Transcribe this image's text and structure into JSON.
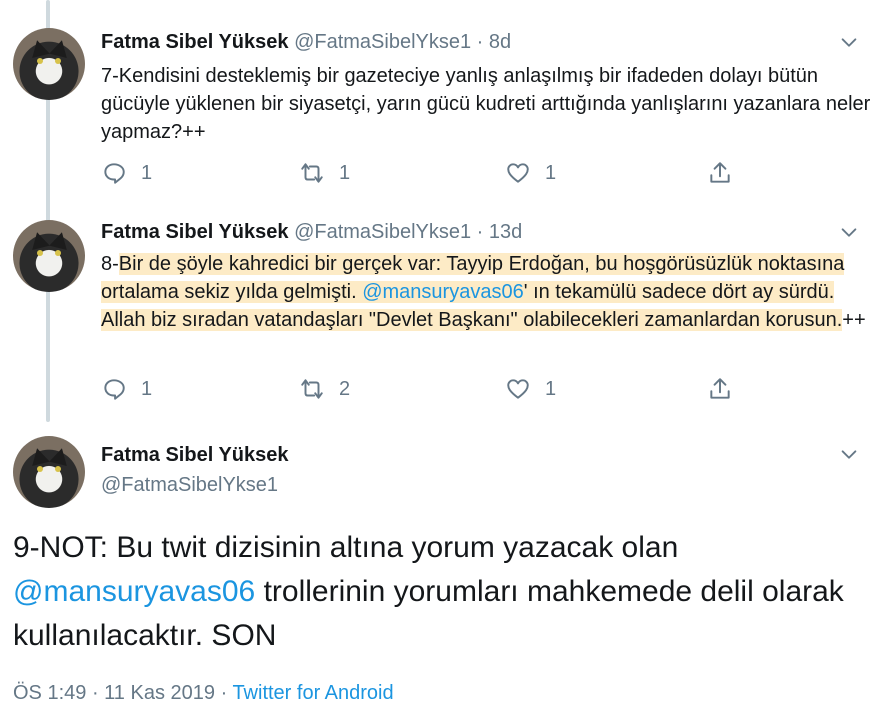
{
  "tweets": [
    {
      "name": "Fatma Sibel Yüksek",
      "handle": "@FatmaSibelYkse1",
      "age": "8d",
      "text": "7-Kendisini desteklemiş bir gazeteciye yanlış anlaşılmış bir ifadeden dolayı bütün gücüyle yüklenen bir siyasetçi, yarın gücü kudreti arttığında yanlışlarını yazanlara neler yapmaz?++",
      "replies": "1",
      "retweets": "1",
      "likes": "1"
    },
    {
      "name": "Fatma Sibel Yüksek",
      "handle": "@FatmaSibelYkse1",
      "age": "13d",
      "text_prefix": "8-",
      "text_hl_a": "Bir de şöyle kahredici bir gerçek var: Tayyip Erdoğan,  bu hoşgörüsüzlük noktasına ortalama sekiz yılda gelmişti. ",
      "mention": "@mansuryavas06",
      "text_hl_b": "' ın tekamülü sadece dört ay sürdü. Allah biz sıradan vatandaşları \"Devlet Başkanı\" olabilecekleri zamanlardan korusun.",
      "text_suffix": "++",
      "replies": "1",
      "retweets": "2",
      "likes": "1"
    }
  ],
  "main_tweet": {
    "name": "Fatma Sibel Yüksek",
    "handle": "@FatmaSibelYkse1",
    "text_a": "9-NOT: Bu twit dizisinin altına yorum yazacak olan ",
    "mention": "@mansuryavas06",
    "text_b": " trollerinin yorumları mahkemede delil olarak kullanılacaktır. SON",
    "time": "ÖS 1:49",
    "date": "11 Kas 2019",
    "source": "Twitter for Android"
  },
  "icons": {
    "reply": "reply-icon",
    "retweet": "retweet-icon",
    "like": "heart-icon",
    "share": "share-icon",
    "menu": "chevron-down-icon"
  },
  "colors": {
    "accent": "#1b95e0",
    "muted": "#657786",
    "highlight": "#fdebc6",
    "thread_line": "#cfd9de"
  }
}
